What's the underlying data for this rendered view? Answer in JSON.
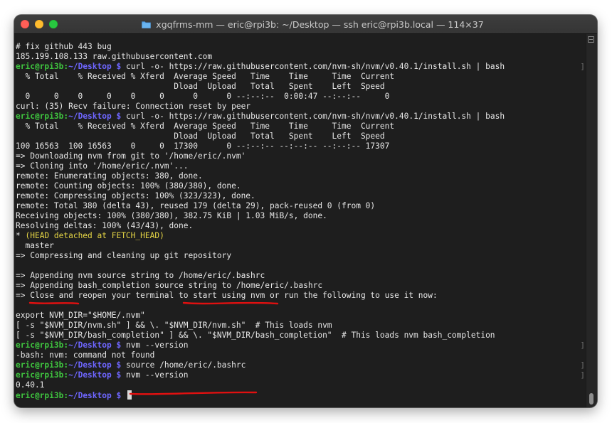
{
  "window": {
    "title": "xgqfrms-mm — eric@rpi3b: ~/Desktop — ssh eric@rpi3b.local — 114×37",
    "folder_icon": "folder-icon"
  },
  "prompt": {
    "user": "eric@rpi3b",
    "sep": ":",
    "path": "~/Desktop",
    "symbol": " $ "
  },
  "lines": {
    "l1": "# fix github 443 bug",
    "l2": "185.199.108.133 raw.githubusercontent.com",
    "l3_cmd": "curl -o- https://raw.githubusercontent.com/nvm-sh/nvm/v0.40.1/install.sh | bash",
    "l4": "  % Total    % Received % Xferd  Average Speed   Time    Time     Time  Current",
    "l5": "                                 Dload  Upload   Total   Spent    Left  Speed",
    "l6": "  0     0    0     0    0     0      0      0 --:--:--  0:00:47 --:--:--     0",
    "l7": "curl: (35) Recv failure: Connection reset by peer",
    "l8_cmd": "curl -o- https://raw.githubusercontent.com/nvm-sh/nvm/v0.40.1/install.sh | bash",
    "l9": "  % Total    % Received % Xferd  Average Speed   Time    Time     Time  Current",
    "l10": "                                 Dload  Upload   Total   Spent    Left  Speed",
    "l11": "100 16563  100 16563    0     0  17300      0 --:--:-- --:--:-- --:--:-- 17307",
    "l12": "=> Downloading nvm from git to '/home/eric/.nvm'",
    "l13": "=> Cloning into '/home/eric/.nvm'...",
    "l14": "remote: Enumerating objects: 380, done.",
    "l15": "remote: Counting objects: 100% (380/380), done.",
    "l16": "remote: Compressing objects: 100% (323/323), done.",
    "l17": "remote: Total 380 (delta 43), reused 179 (delta 29), pack-reused 0 (from 0)",
    "l18": "Receiving objects: 100% (380/380), 382.75 KiB | 1.03 MiB/s, done.",
    "l19": "Resolving deltas: 100% (43/43), done.",
    "l20_star": "* ",
    "l20_rest": "(HEAD detached at FETCH_HEAD)",
    "l21": "  master",
    "l22": "=> Compressing and cleaning up git repository",
    "l23": "",
    "l24": "=> Appending nvm source string to /home/eric/.bashrc",
    "l25": "=> Appending bash_completion source string to /home/eric/.bashrc",
    "l26": "=> Close and reopen your terminal to start using nvm or run the following to use it now:",
    "l27": "",
    "l28": "export NVM_DIR=\"$HOME/.nvm\"",
    "l29": "[ -s \"$NVM_DIR/nvm.sh\" ] && \\. \"$NVM_DIR/nvm.sh\"  # This loads nvm",
    "l30": "[ -s \"$NVM_DIR/bash_completion\" ] && \\. \"$NVM_DIR/bash_completion\"  # This loads nvm bash_completion",
    "l31_cmd": "nvm --version",
    "l32": "-bash: nvm: command not found",
    "l33_cmd": "source /home/eric/.bashrc",
    "l34_cmd": "nvm --version",
    "l35": "0.40.1",
    "l36_cmd": ""
  },
  "right_marks": {
    "bracket": "]"
  },
  "colors": {
    "prompt_user": "#3fc63f",
    "prompt_path": "#6e66ff",
    "annotation": "#e01010",
    "head_detached": "#e5d545"
  }
}
